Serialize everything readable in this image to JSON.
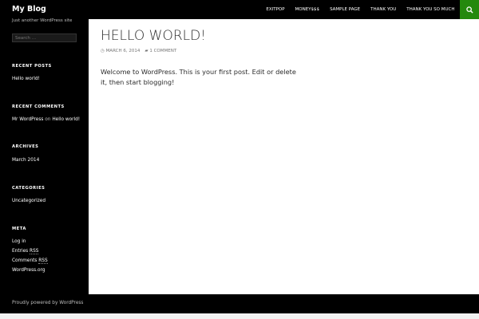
{
  "site": {
    "title": "My Blog",
    "tagline": "Just another WordPress site"
  },
  "nav": [
    "EXITPOP",
    "MONEY$$$",
    "SAMPLE PAGE",
    "THANK YOU",
    "THANK YOU SO MUCH"
  ],
  "accent": "#24890d",
  "search": {
    "placeholder": "Search …"
  },
  "widgets": {
    "recent_posts": {
      "title": "RECENT POSTS",
      "items": [
        "Hello world!"
      ]
    },
    "recent_comments": {
      "title": "RECENT COMMENTS",
      "author": "Mr WordPress",
      "on": "on",
      "post": "Hello world!"
    },
    "archives": {
      "title": "ARCHIVES",
      "items": [
        "March 2014"
      ]
    },
    "categories": {
      "title": "CATEGORIES",
      "items": [
        "Uncategorized"
      ]
    },
    "meta": {
      "title": "META",
      "login": "Log in",
      "entries": "Entries",
      "comments": "Comments",
      "rss": "RSS",
      "wporg": "WordPress.org"
    }
  },
  "post": {
    "title": "HELLO WORLD!",
    "date": "MARCH 6, 2014",
    "comments": "1 COMMENT",
    "body": "Welcome to WordPress. This is your first post. Edit or delete it, then start blogging!"
  },
  "footer": {
    "credit": "Proudly powered by WordPress"
  }
}
